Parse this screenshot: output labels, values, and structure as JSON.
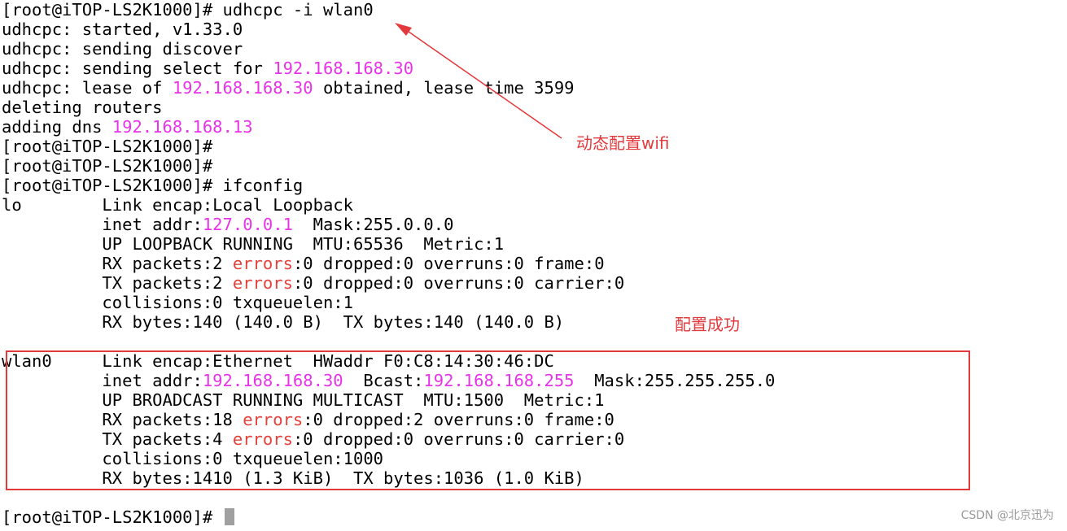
{
  "terminal": {
    "lines": [
      [
        {
          "t": "[root@iTOP-LS2K1000]# udhcpc -i wlan0"
        }
      ],
      [
        {
          "t": "udhcpc: started, v1.33.0"
        }
      ],
      [
        {
          "t": "udhcpc: sending discover"
        }
      ],
      [
        {
          "t": "udhcpc: sending select for "
        },
        {
          "t": "192.168.168.30",
          "c": "hl"
        }
      ],
      [
        {
          "t": "udhcpc: lease of "
        },
        {
          "t": "192.168.168.30",
          "c": "hl"
        },
        {
          "t": " obtained, lease time 3599"
        }
      ],
      [
        {
          "t": "deleting routers"
        }
      ],
      [
        {
          "t": "adding dns "
        },
        {
          "t": "192.168.168.13",
          "c": "hl"
        }
      ],
      [
        {
          "t": "[root@iTOP-LS2K1000]#"
        }
      ],
      [
        {
          "t": "[root@iTOP-LS2K1000]#"
        }
      ],
      [
        {
          "t": "[root@iTOP-LS2K1000]# ifconfig"
        }
      ],
      [
        {
          "t": "lo        Link encap:Local Loopback"
        }
      ],
      [
        {
          "t": "          inet addr:"
        },
        {
          "t": "127.0.0.1",
          "c": "hl"
        },
        {
          "t": "  Mask:255.0.0.0"
        }
      ],
      [
        {
          "t": "          UP LOOPBACK RUNNING  MTU:65536  Metric:1"
        }
      ],
      [
        {
          "t": "          RX packets:2 "
        },
        {
          "t": "errors",
          "c": "err"
        },
        {
          "t": ":0 dropped:0 overruns:0 frame:0"
        }
      ],
      [
        {
          "t": "          TX packets:2 "
        },
        {
          "t": "errors",
          "c": "err"
        },
        {
          "t": ":0 dropped:0 overruns:0 carrier:0"
        }
      ],
      [
        {
          "t": "          collisions:0 txqueuelen:1"
        }
      ],
      [
        {
          "t": "          RX bytes:140 (140.0 B)  TX bytes:140 (140.0 B)"
        }
      ],
      [
        {
          "t": ""
        }
      ],
      [
        {
          "t": "wlan0     Link encap:Ethernet  HWaddr F0:C8:14:30:46:DC"
        }
      ],
      [
        {
          "t": "          inet addr:"
        },
        {
          "t": "192.168.168.30",
          "c": "hl"
        },
        {
          "t": "  Bcast:"
        },
        {
          "t": "192.168.168.255",
          "c": "hl"
        },
        {
          "t": "  Mask:255.255.255.0"
        }
      ],
      [
        {
          "t": "          UP BROADCAST RUNNING MULTICAST  MTU:1500  Metric:1"
        }
      ],
      [
        {
          "t": "          RX packets:18 "
        },
        {
          "t": "errors",
          "c": "err"
        },
        {
          "t": ":0 dropped:2 overruns:0 frame:0"
        }
      ],
      [
        {
          "t": "          TX packets:4 "
        },
        {
          "t": "errors",
          "c": "err"
        },
        {
          "t": ":0 dropped:0 overruns:0 carrier:0"
        }
      ],
      [
        {
          "t": "          collisions:0 txqueuelen:1000"
        }
      ],
      [
        {
          "t": "          RX bytes:1410 (1.3 KiB)  TX bytes:1036 (1.0 KiB)"
        }
      ],
      [
        {
          "t": ""
        }
      ],
      [
        {
          "t": "[root@iTOP-LS2K1000]# "
        }
      ]
    ]
  },
  "annotations": {
    "wifi": "动态配置wifi",
    "success": "配置成功"
  },
  "watermark": "CSDN @北京迅为",
  "colors": {
    "highlight": "#e834e8",
    "error": "#e5403a",
    "annotation": "#e4393c",
    "cursor": "#a0a0a0"
  }
}
